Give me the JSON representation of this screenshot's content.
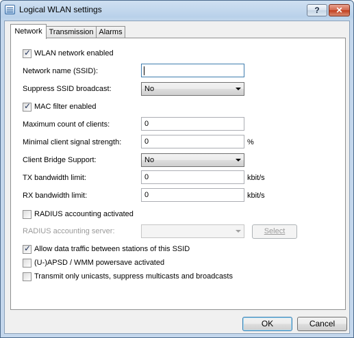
{
  "window": {
    "title": "Logical WLAN settings",
    "help_label": "?",
    "close_label": "✕"
  },
  "tabs": [
    {
      "label": "Network",
      "active": true
    },
    {
      "label": "Transmission",
      "active": false
    },
    {
      "label": "Alarms",
      "active": false
    }
  ],
  "form": {
    "wlan_enabled": {
      "label": "WLAN network enabled",
      "checked": true
    },
    "ssid": {
      "label": "Network name (SSID):",
      "value": ""
    },
    "suppress_ssid": {
      "label": "Suppress SSID broadcast:",
      "value": "No"
    },
    "mac_filter": {
      "label": "MAC filter enabled",
      "checked": true
    },
    "max_clients": {
      "label": "Maximum count of clients:",
      "value": "0"
    },
    "min_signal": {
      "label": "Minimal client signal strength:",
      "value": "0",
      "unit": "%"
    },
    "client_bridge": {
      "label": "Client Bridge Support:",
      "value": "No"
    },
    "tx_limit": {
      "label": "TX bandwidth limit:",
      "value": "0",
      "unit": "kbit/s"
    },
    "rx_limit": {
      "label": "RX bandwidth limit:",
      "value": "0",
      "unit": "kbit/s"
    },
    "radius_accounting": {
      "label": "RADIUS accounting activated",
      "checked": false
    },
    "radius_server": {
      "label": "RADIUS accounting server:",
      "value": "",
      "select_label": "Select"
    },
    "allow_traffic": {
      "label": "Allow data traffic between stations of this SSID",
      "checked": true
    },
    "apsd": {
      "label": "(U-)APSD / WMM powersave activated",
      "checked": false
    },
    "unicast_only": {
      "label": "Transmit only unicasts, suppress multicasts and broadcasts",
      "checked": false
    }
  },
  "footer": {
    "ok_label": "OK",
    "cancel_label": "Cancel"
  }
}
